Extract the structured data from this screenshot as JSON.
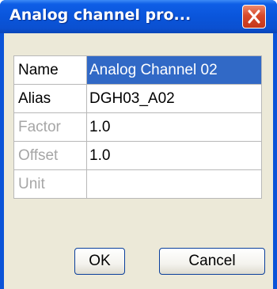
{
  "window": {
    "title": "Analog channel pro..."
  },
  "properties": [
    {
      "key": "Name",
      "value": "Analog Channel 02",
      "key_enabled": true,
      "selected": true
    },
    {
      "key": "Alias",
      "value": "DGH03_A02",
      "key_enabled": true,
      "selected": false
    },
    {
      "key": "Factor",
      "value": "1.0",
      "key_enabled": false,
      "selected": false
    },
    {
      "key": "Offset",
      "value": "1.0",
      "key_enabled": false,
      "selected": false
    },
    {
      "key": "Unit",
      "value": "",
      "key_enabled": false,
      "selected": false
    }
  ],
  "buttons": {
    "ok_label": "OK",
    "cancel_label": "Cancel"
  },
  "icons": {
    "close": "close-icon"
  },
  "colors": {
    "title_bar": "#0a55db",
    "close_button": "#d6492a",
    "dialog_background": "#ece9d8",
    "selection": "#3169c6",
    "disabled_text": "#a6a6a6"
  }
}
